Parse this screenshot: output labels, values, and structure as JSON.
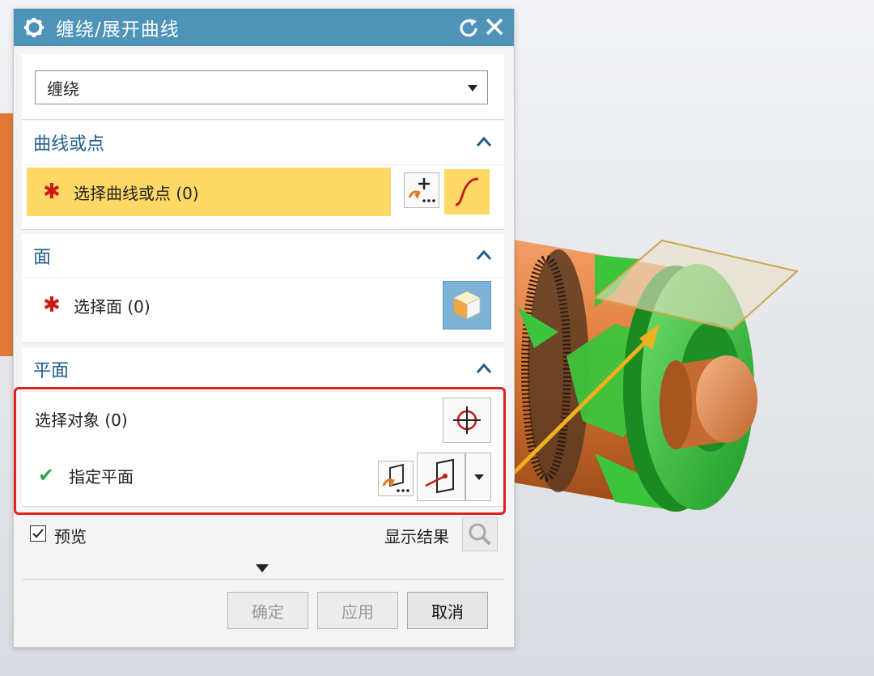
{
  "dialog": {
    "title": "缠绕/展开曲线",
    "icons": {
      "settings": "gear-icon",
      "reset": "reset-icon",
      "close": "close-icon"
    }
  },
  "type_select": {
    "value": "缠绕"
  },
  "sections": {
    "curve": {
      "header": "曲线或点",
      "select_label": "选择曲线或点 (0)"
    },
    "face": {
      "header": "面",
      "select_label": "选择面 (0)"
    },
    "plane": {
      "header": "平面",
      "select_object_label": "选择对象 (0)",
      "specify_plane_label": "指定平面"
    }
  },
  "footer": {
    "preview_label": "预览",
    "preview_checked": true,
    "show_result_label": "显示结果",
    "ok_label": "确定",
    "apply_label": "应用",
    "cancel_label": "取消"
  },
  "colors": {
    "title_bar": "#4e93b8",
    "section_header_text": "#1f5f8e",
    "required_highlight": "#ffd966",
    "required_mark": "#d01818",
    "annotation_frame": "#e02020",
    "check_mark": "#2fa84a"
  }
}
